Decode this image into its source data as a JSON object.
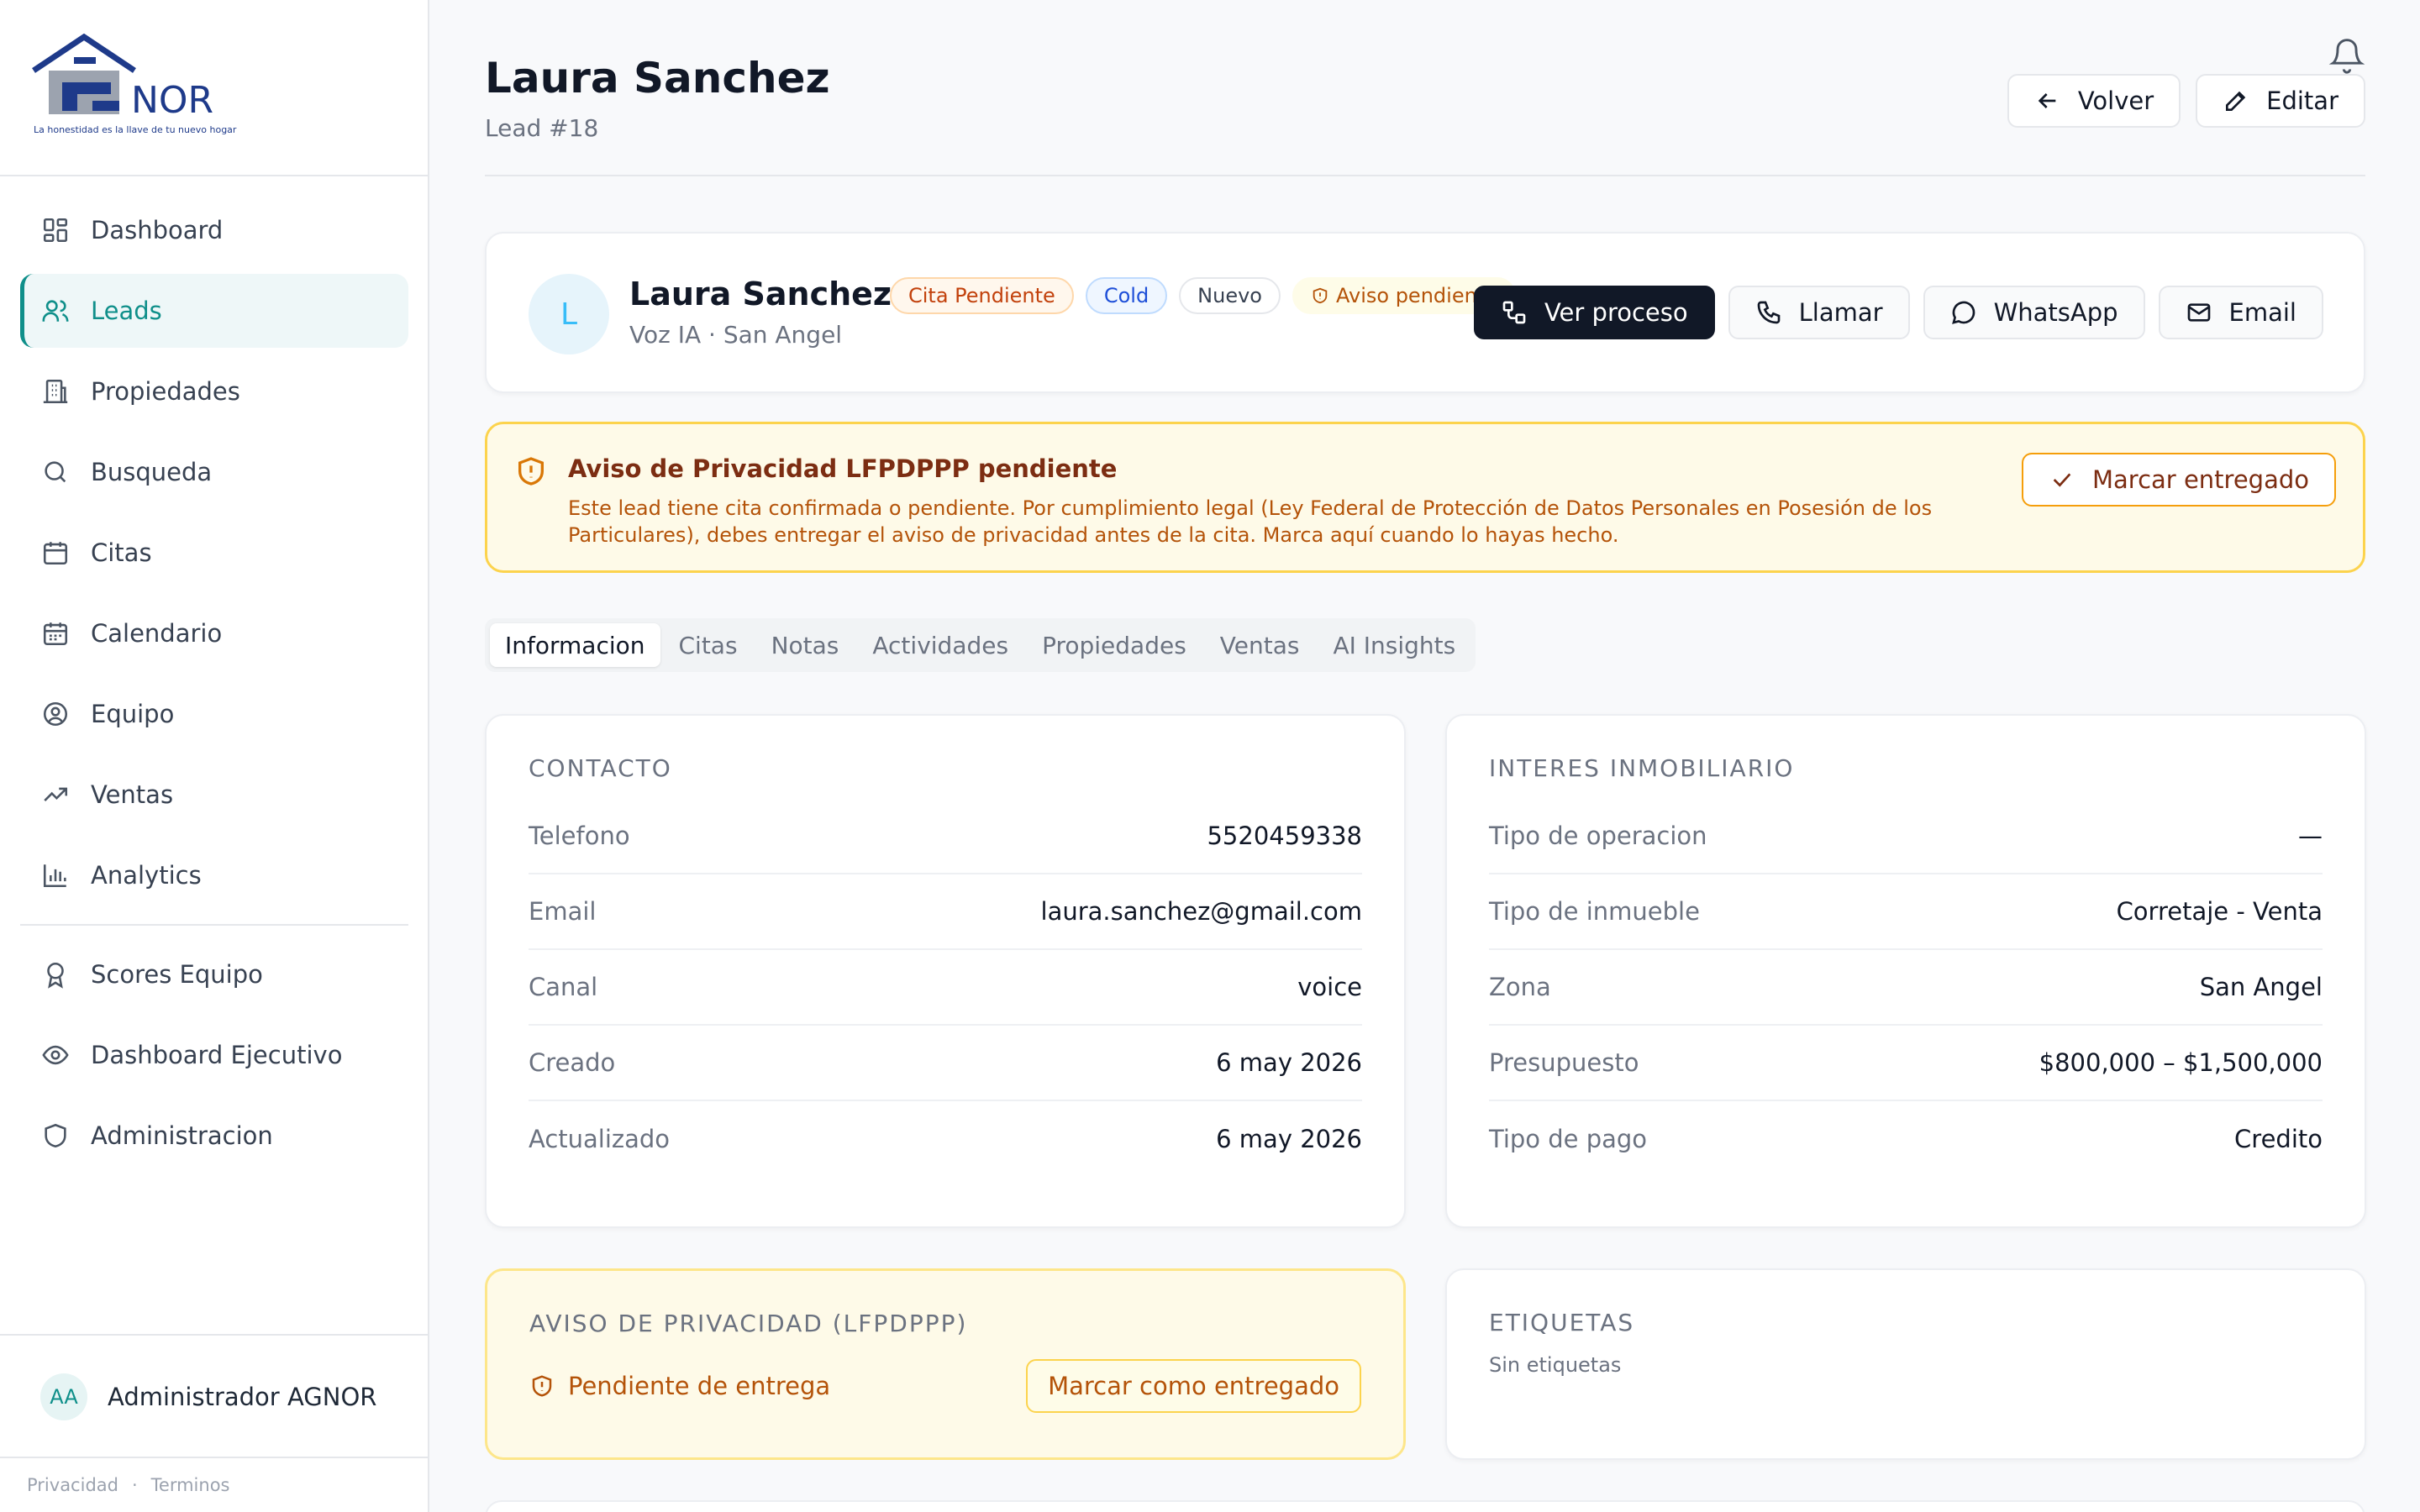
{
  "brand": {
    "logo_text": "NOR",
    "tagline": "La honestidad es la llave de tu nuevo hogar",
    "colors": {
      "accent": "#0f8f8a",
      "navy": "#1e3a8a"
    }
  },
  "sidebar": {
    "items": [
      {
        "label": "Dashboard",
        "icon": "dashboard-icon"
      },
      {
        "label": "Leads",
        "icon": "users-icon"
      },
      {
        "label": "Propiedades",
        "icon": "building-icon"
      },
      {
        "label": "Busqueda",
        "icon": "search-icon"
      },
      {
        "label": "Citas",
        "icon": "calendar-icon"
      },
      {
        "label": "Calendario",
        "icon": "calendar-grid-icon"
      },
      {
        "label": "Equipo",
        "icon": "user-circle-icon"
      },
      {
        "label": "Ventas",
        "icon": "trending-up-icon"
      },
      {
        "label": "Analytics",
        "icon": "bar-chart-icon"
      }
    ],
    "secondary_items": [
      {
        "label": "Scores Equipo",
        "icon": "award-icon"
      },
      {
        "label": "Dashboard Ejecutivo",
        "icon": "eye-icon"
      },
      {
        "label": "Administracion",
        "icon": "shield-icon"
      }
    ],
    "user": {
      "initials": "AA",
      "name": "Administrador AGNOR"
    },
    "footer": {
      "privacy": "Privacidad",
      "separator": "·",
      "terms": "Terminos"
    }
  },
  "header": {
    "title": "Laura Sanchez",
    "subtitle": "Lead #18",
    "back_label": "Volver",
    "edit_label": "Editar"
  },
  "lead": {
    "initial": "L",
    "name": "Laura Sanchez",
    "meta": "Voz IA · San Angel",
    "badges": {
      "appointment": "Cita Pendiente",
      "temperature": "Cold",
      "status": "Nuevo",
      "notice": "Aviso pendiente"
    },
    "actions": {
      "process": "Ver proceso",
      "call": "Llamar",
      "whatsapp": "WhatsApp",
      "email": "Email"
    }
  },
  "alert": {
    "title": "Aviso de Privacidad LFPDPPP pendiente",
    "text": "Este lead tiene cita confirmada o pendiente. Por cumplimiento legal (Ley Federal de Protección de Datos Personales en Posesión de los Particulares), debes entregar el aviso de privacidad antes de la cita. Marca aquí cuando lo hayas hecho.",
    "button": "Marcar entregado"
  },
  "tabs": [
    "Informacion",
    "Citas",
    "Notas",
    "Actividades",
    "Propiedades",
    "Ventas",
    "AI Insights"
  ],
  "contacto": {
    "title": "CONTACTO",
    "rows": [
      {
        "label": "Telefono",
        "value": "5520459338"
      },
      {
        "label": "Email",
        "value": "laura.sanchez@gmail.com"
      },
      {
        "label": "Canal",
        "value": "voice"
      },
      {
        "label": "Creado",
        "value": "6 may 2026"
      },
      {
        "label": "Actualizado",
        "value": "6 may 2026"
      }
    ]
  },
  "interes": {
    "title": "INTERES INMOBILIARIO",
    "rows": [
      {
        "label": "Tipo de operacion",
        "value": "—"
      },
      {
        "label": "Tipo de inmueble",
        "value": "Corretaje - Venta"
      },
      {
        "label": "Zona",
        "value": "San Angel"
      },
      {
        "label": "Presupuesto",
        "value": "$800,000 – $1,500,000"
      },
      {
        "label": "Tipo de pago",
        "value": "Credito"
      }
    ]
  },
  "privacidad": {
    "title": "AVISO DE PRIVACIDAD (LFPDPPP)",
    "status": "Pendiente de entrega",
    "button": "Marcar como entregado"
  },
  "etiquetas": {
    "title": "ETIQUETAS",
    "empty": "Sin etiquetas"
  }
}
